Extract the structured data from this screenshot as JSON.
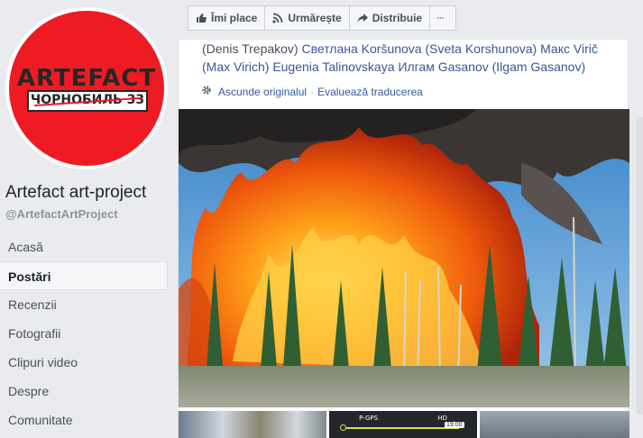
{
  "page": {
    "name": "Artefact art-project",
    "handle": "@ArtefactArtProject",
    "logo": {
      "line1": "ARTEFACT",
      "line2": "ЧОРНОБИЛЬ 33"
    }
  },
  "nav": {
    "items": [
      {
        "label": "Acasă"
      },
      {
        "label": "Postări"
      },
      {
        "label": "Recenzii"
      },
      {
        "label": "Fotografii"
      },
      {
        "label": "Clipuri video"
      },
      {
        "label": "Despre"
      },
      {
        "label": "Comunitate"
      }
    ],
    "active_index": 1
  },
  "actions": {
    "like": "Îmi place",
    "follow": "Urmărește",
    "share": "Distribuie"
  },
  "post": {
    "text_prefix": "(Denis Trepakov) ",
    "tags": [
      "Светлана Koršunova (Sveta Korshunova)",
      "Макс Virič (Max Virich)",
      "Eugenia Talinovskaya",
      "Илгам Gasanov (Ilgam Gasanov)"
    ],
    "hide_original": "Ascunde originalul",
    "rate_translation": "Evaluează traducerea",
    "separator": "·"
  },
  "thumb_hud": {
    "time": "19:00",
    "label": "P-GPS",
    "quality": "HD"
  },
  "colors": {
    "link": "#365899",
    "brand_red": "#ee1b24",
    "background": "#e9ebee"
  }
}
